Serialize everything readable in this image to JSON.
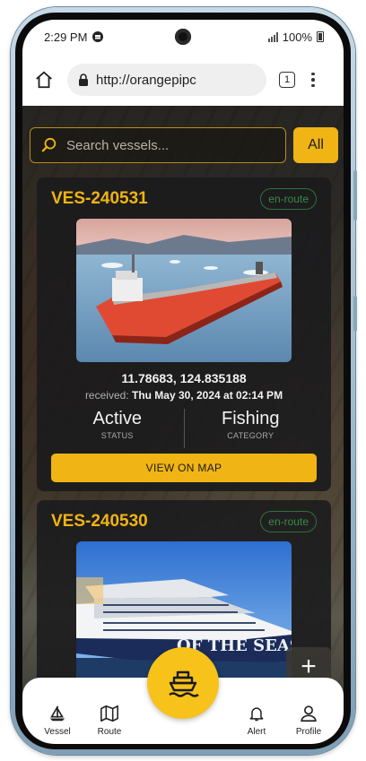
{
  "status_bar": {
    "time": "2:29 PM",
    "battery": "100%"
  },
  "browser": {
    "url": "http://orangepipc",
    "tab_count": "1"
  },
  "search": {
    "placeholder": "Search vessels...",
    "filter_label": "All"
  },
  "vessels": [
    {
      "id": "VES-240531",
      "badge": "en-route",
      "coordinates": "11.78683, 124.835188",
      "received_label": "received:",
      "received_value": "Thu May 30, 2024 at 02:14 PM",
      "status_value": "Active",
      "status_label": "STATUS",
      "category_value": "Fishing",
      "category_label": "CATEGORY",
      "button_label": "VIEW ON MAP"
    },
    {
      "id": "VES-240530",
      "badge": "en-route",
      "image_text": "OF THE SEAS"
    }
  ],
  "add_button": "+",
  "nav": {
    "vessel": "Vessel",
    "route": "Route",
    "alert": "Alert",
    "profile": "Profile"
  },
  "colors": {
    "accent": "#f0b414",
    "badge": "#3a8a4a"
  }
}
